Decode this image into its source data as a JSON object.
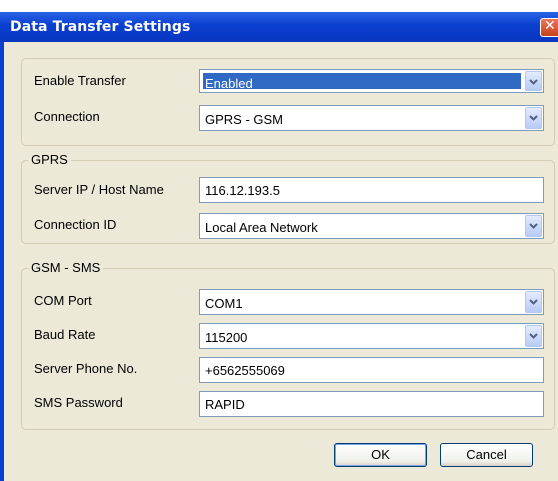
{
  "window": {
    "title": "Data Transfer Settings",
    "close_glyph": "✕"
  },
  "transfer": {
    "enable_label": "Enable Transfer",
    "enable_value": "Enabled",
    "connection_label": "Connection",
    "connection_value": "GPRS - GSM"
  },
  "gprs": {
    "legend": "GPRS",
    "server_label": "Server IP / Host Name",
    "server_value": "116.12.193.5",
    "connection_id_label": "Connection ID",
    "connection_id_value": "Local Area Network"
  },
  "gsm": {
    "legend": "GSM - SMS",
    "com_port_label": "COM Port",
    "com_port_value": "COM1",
    "baud_label": "Baud Rate",
    "baud_value": "115200",
    "phone_label": "Server Phone No.",
    "phone_value": "+6562555069",
    "password_label": "SMS Password",
    "password_value": "RAPID"
  },
  "buttons": {
    "ok": "OK",
    "cancel": "Cancel"
  },
  "icons": {
    "close": "close-icon",
    "dropdown": "chevron-down-icon"
  },
  "colors": {
    "title_bar": "#0a3fcf",
    "dialog_bg": "#ece9d8",
    "selection": "#316ac5"
  }
}
